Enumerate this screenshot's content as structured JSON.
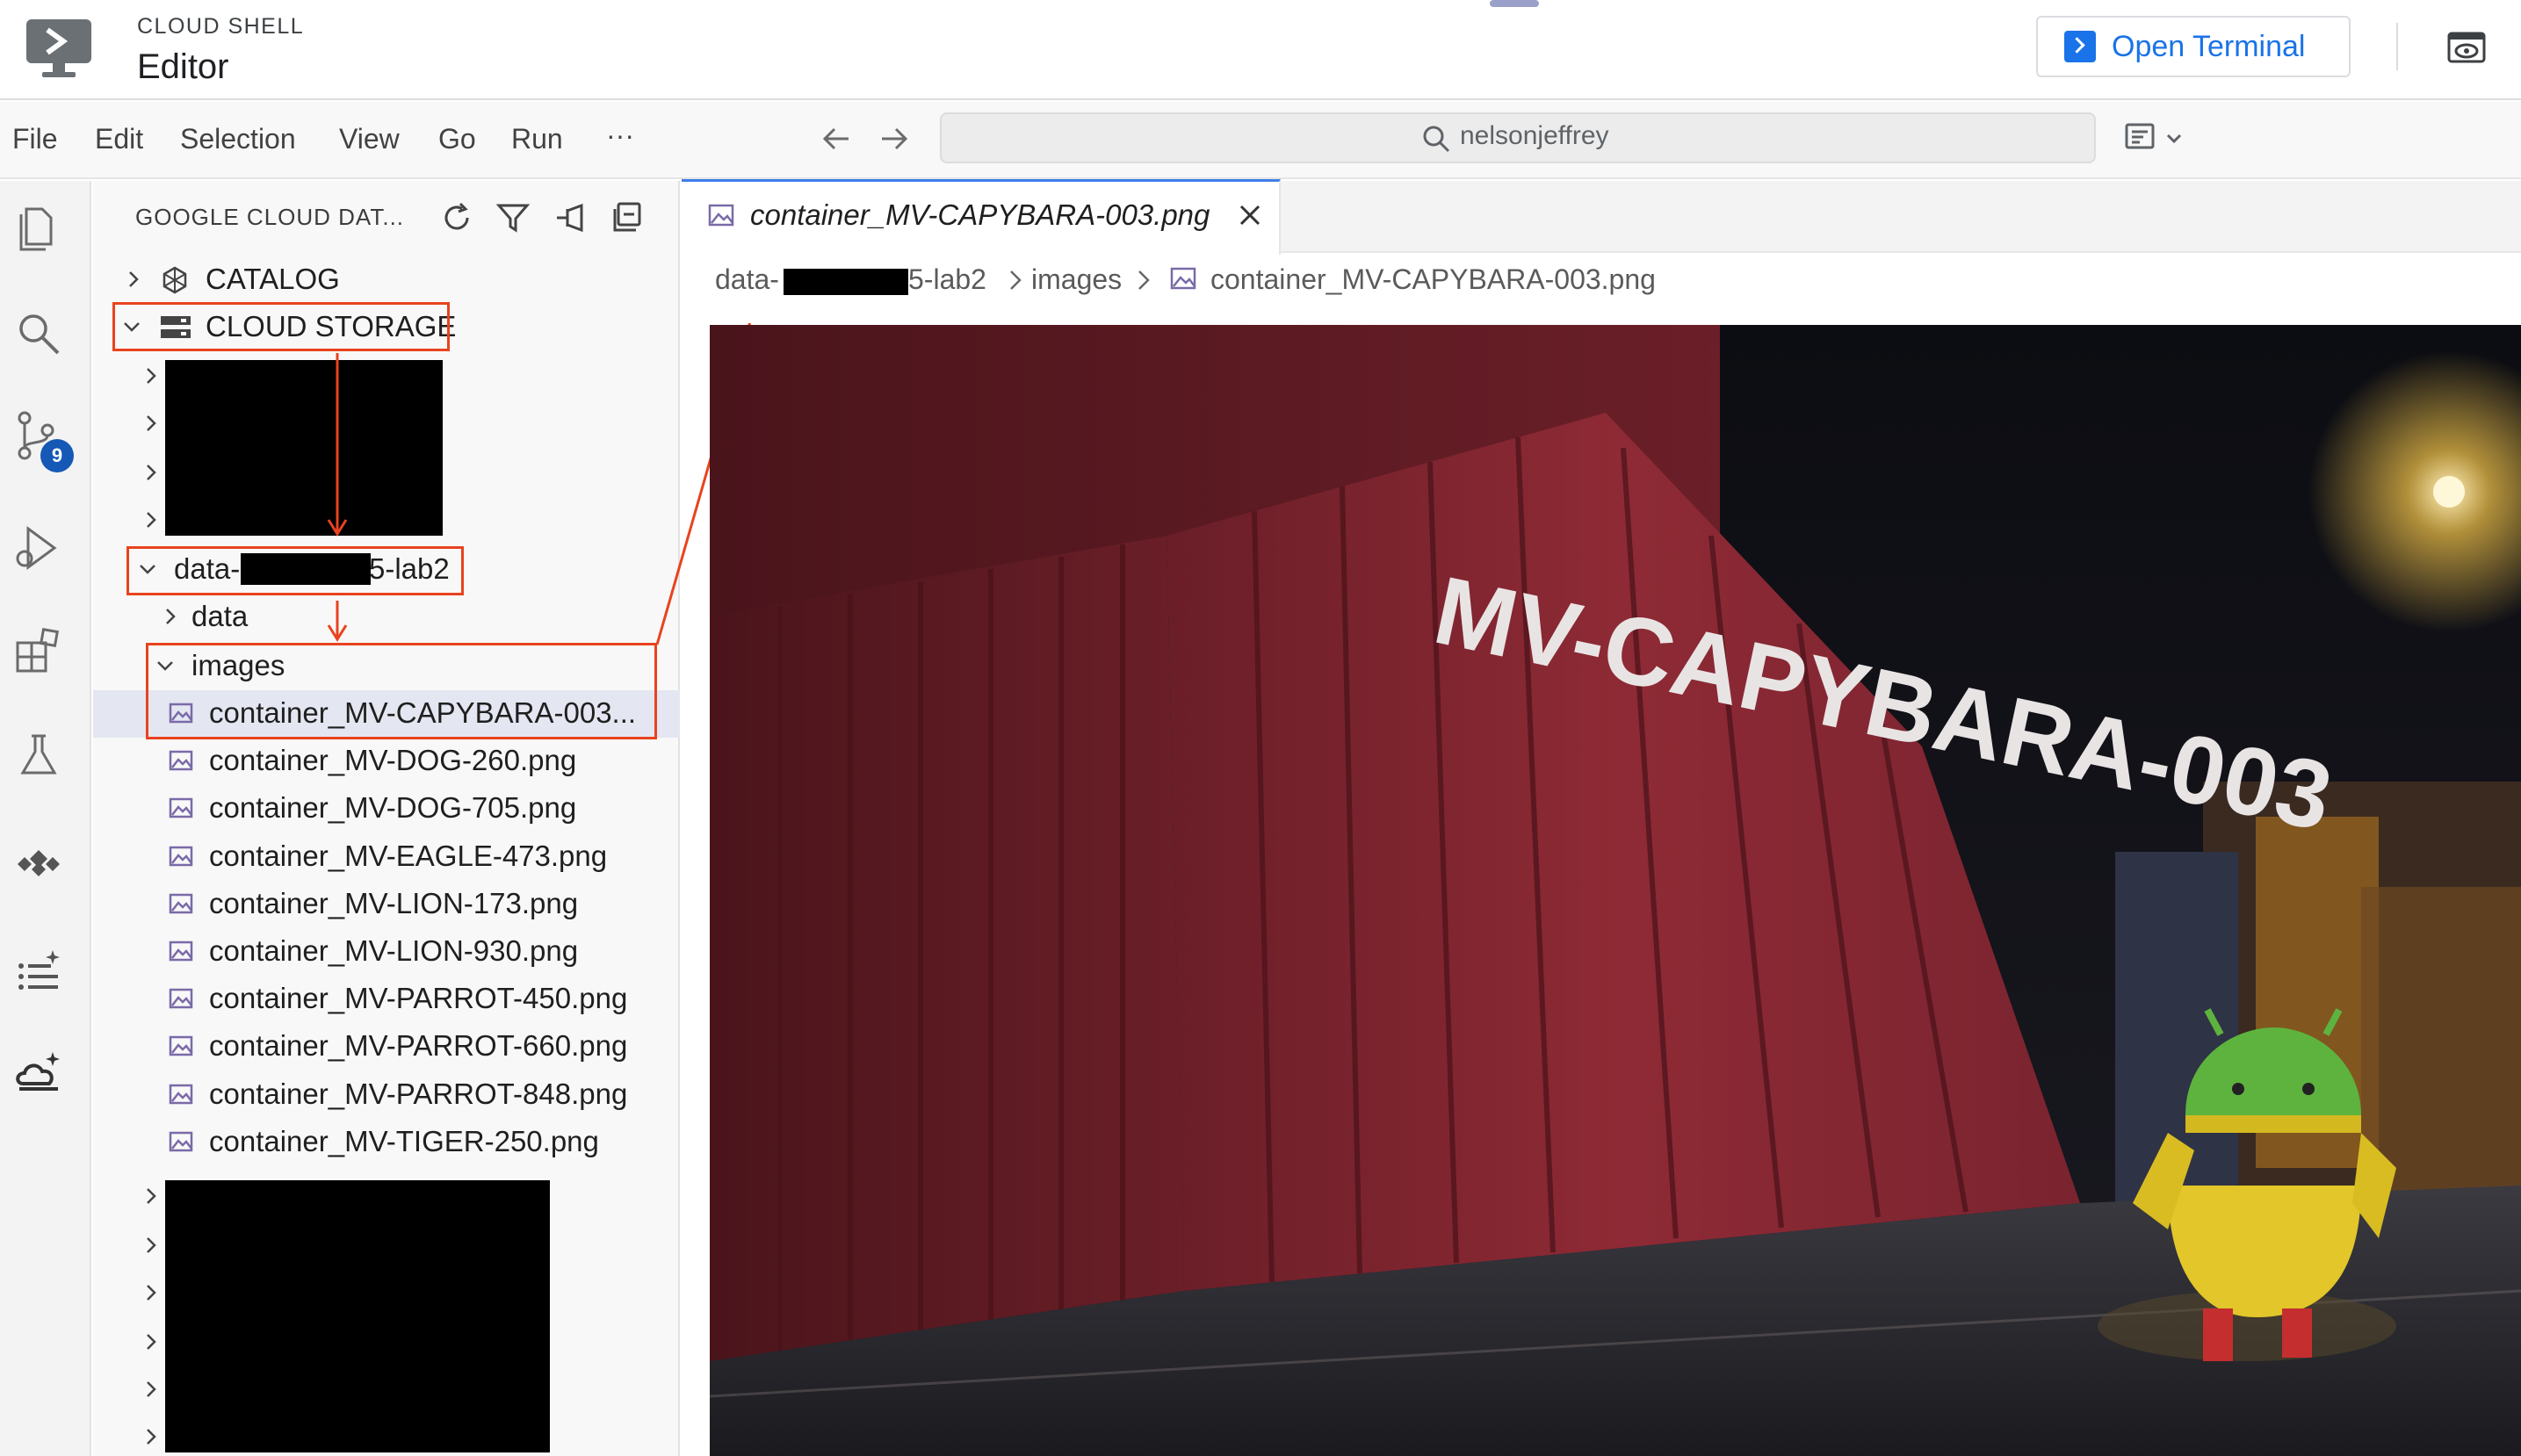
{
  "header": {
    "brand": "CLOUD SHELL",
    "title": "Editor",
    "open_terminal_label": "Open Terminal",
    "accent_color": "#1a73e8"
  },
  "menubar": {
    "items": [
      "File",
      "Edit",
      "Selection",
      "View",
      "Go",
      "Run",
      "···"
    ],
    "search_text": "nelsonjeffrey"
  },
  "activity_bar": {
    "icons": [
      "explorer-icon",
      "search-icon",
      "source-control-icon",
      "run-debug-icon",
      "extensions-icon",
      "testing-icon",
      "cloud-code-icon",
      "tasks-icon",
      "gemini-cloud-icon"
    ],
    "scm_badge": "9"
  },
  "sidebar": {
    "title": "GOOGLE CLOUD DAT...",
    "catalog_label": "CATALOG",
    "storage_label": "CLOUD STORAGE",
    "bucket_prefix": "data-",
    "bucket_suffix": "5-lab2",
    "folder_data": "data",
    "folder_images": "images",
    "files": [
      "container_MV-CAPYBARA-003...",
      "container_MV-DOG-260.png",
      "container_MV-DOG-705.png",
      "container_MV-EAGLE-473.png",
      "container_MV-LION-173.png",
      "container_MV-LION-930.png",
      "container_MV-PARROT-450.png",
      "container_MV-PARROT-660.png",
      "container_MV-PARROT-848.png",
      "container_MV-TIGER-250.png"
    ],
    "highlight_color": "#e8431e"
  },
  "editor": {
    "tab_label": "container_MV-CAPYBARA-003.png",
    "breadcrumb": {
      "bucket_prefix": "data-",
      "bucket_suffix": "5-lab2",
      "folder": "images",
      "file": "container_MV-CAPYBARA-003.png"
    },
    "image": {
      "container_text": "MV-CAPYBARA-003",
      "container_color": "#8e2a35"
    }
  }
}
